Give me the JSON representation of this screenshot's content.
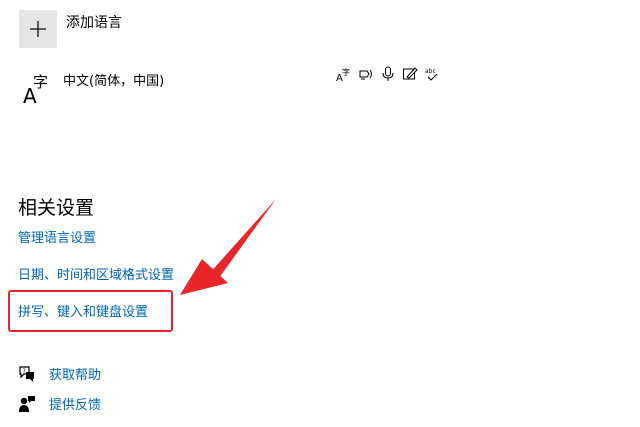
{
  "language_list": {
    "add_language_label": "添加语言",
    "items": [
      {
        "name": "中文(简体，中国)",
        "feature_icons": [
          "display-language-icon",
          "text-to-speech-icon",
          "speech-recognition-icon",
          "handwriting-icon",
          "spell-check-icon"
        ]
      }
    ]
  },
  "related_settings": {
    "title": "相关设置",
    "links": [
      "管理语言设置",
      "日期、时间和区域格式设置",
      "拼写、键入和键盘设置"
    ]
  },
  "help": {
    "get_help": "获取帮助",
    "feedback": "提供反馈"
  },
  "colors": {
    "link": "#0067b8",
    "annotation_red": "#e8262a",
    "plus_box_bg": "#e5e5e5"
  }
}
